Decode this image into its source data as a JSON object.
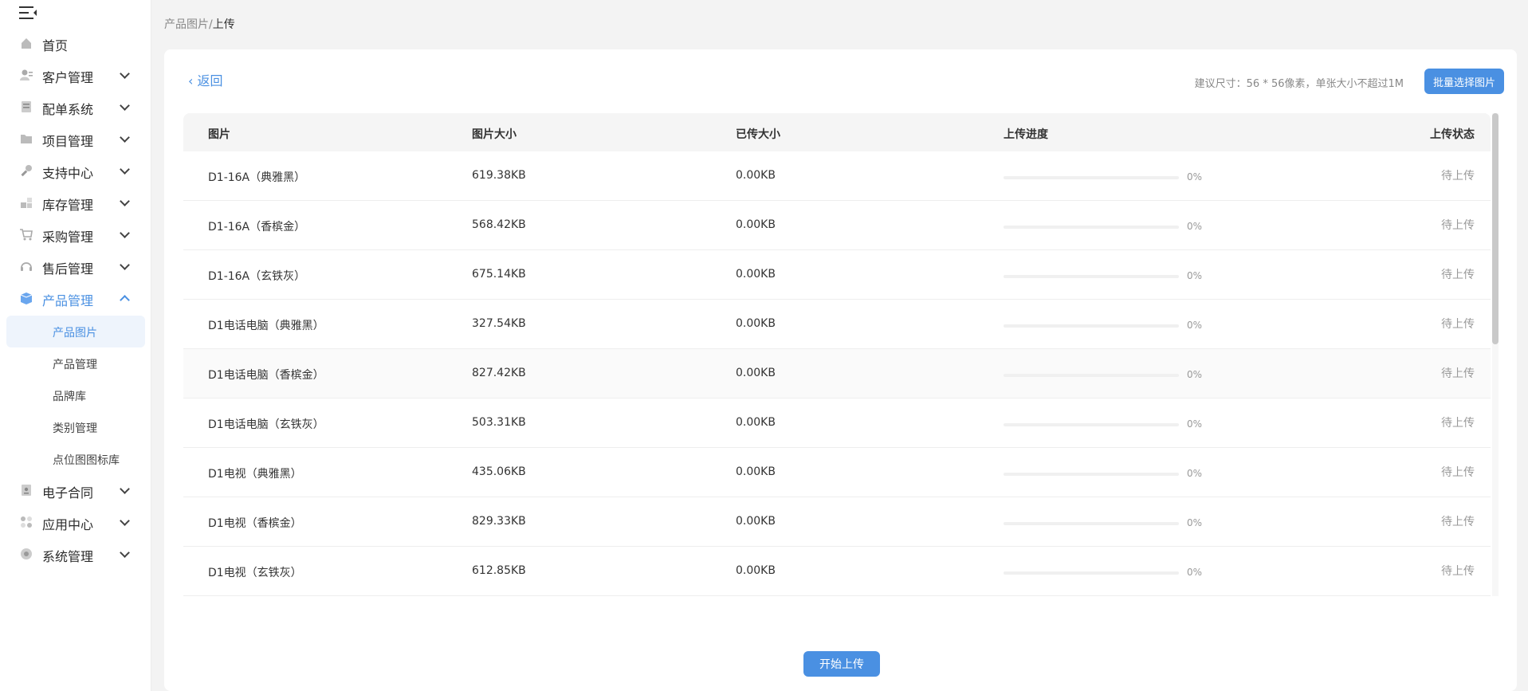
{
  "sidebar": {
    "items": [
      {
        "label": "首页",
        "icon": "home-icon",
        "expandable": false
      },
      {
        "label": "客户管理",
        "icon": "customer-icon",
        "expandable": true
      },
      {
        "label": "配单系统",
        "icon": "order-icon",
        "expandable": true
      },
      {
        "label": "项目管理",
        "icon": "folder-icon",
        "expandable": true
      },
      {
        "label": "支持中心",
        "icon": "wrench-icon",
        "expandable": true
      },
      {
        "label": "库存管理",
        "icon": "inventory-icon",
        "expandable": true
      },
      {
        "label": "采购管理",
        "icon": "cart-icon",
        "expandable": true
      },
      {
        "label": "售后管理",
        "icon": "headset-icon",
        "expandable": true
      },
      {
        "label": "产品管理",
        "icon": "box-icon",
        "expandable": true,
        "active": true
      }
    ],
    "sub_items": [
      {
        "label": "产品图片",
        "active": true
      },
      {
        "label": "产品管理"
      },
      {
        "label": "品牌库"
      },
      {
        "label": "类别管理"
      },
      {
        "label": "点位图图标库"
      }
    ],
    "bottom_items": [
      {
        "label": "电子合同",
        "icon": "contract-icon",
        "expandable": true
      },
      {
        "label": "应用中心",
        "icon": "apps-icon",
        "expandable": true
      },
      {
        "label": "系统管理",
        "icon": "gear-icon",
        "expandable": true
      }
    ]
  },
  "breadcrumb": {
    "parent": "产品图片",
    "separator": "/",
    "current": "上传"
  },
  "toolbar": {
    "back_label": "返回",
    "hint": "建议尺寸：56 * 56像素，单张大小不超过1M",
    "batch_select_label": "批量选择图片"
  },
  "table": {
    "columns": [
      "图片",
      "图片大小",
      "已传大小",
      "上传进度",
      "上传状态"
    ],
    "rows": [
      {
        "name": "D1-16A（典雅黑）",
        "size": "619.38KB",
        "uploaded": "0.00KB",
        "progress": 0,
        "progress_label": "0%",
        "status": "待上传"
      },
      {
        "name": "D1-16A（香槟金）",
        "size": "568.42KB",
        "uploaded": "0.00KB",
        "progress": 0,
        "progress_label": "0%",
        "status": "待上传"
      },
      {
        "name": "D1-16A（玄铁灰）",
        "size": "675.14KB",
        "uploaded": "0.00KB",
        "progress": 0,
        "progress_label": "0%",
        "status": "待上传"
      },
      {
        "name": "D1电话电脑（典雅黑）",
        "size": "327.54KB",
        "uploaded": "0.00KB",
        "progress": 0,
        "progress_label": "0%",
        "status": "待上传"
      },
      {
        "name": "D1电话电脑（香槟金）",
        "size": "827.42KB",
        "uploaded": "0.00KB",
        "progress": 0,
        "progress_label": "0%",
        "status": "待上传"
      },
      {
        "name": "D1电话电脑（玄铁灰）",
        "size": "503.31KB",
        "uploaded": "0.00KB",
        "progress": 0,
        "progress_label": "0%",
        "status": "待上传"
      },
      {
        "name": "D1电视（典雅黑）",
        "size": "435.06KB",
        "uploaded": "0.00KB",
        "progress": 0,
        "progress_label": "0%",
        "status": "待上传"
      },
      {
        "name": "D1电视（香槟金）",
        "size": "829.33KB",
        "uploaded": "0.00KB",
        "progress": 0,
        "progress_label": "0%",
        "status": "待上传"
      },
      {
        "name": "D1电视（玄铁灰）",
        "size": "612.85KB",
        "uploaded": "0.00KB",
        "progress": 0,
        "progress_label": "0%",
        "status": "待上传"
      }
    ]
  },
  "footer": {
    "start_upload_label": "开始上传"
  },
  "colors": {
    "accent": "#4a90e2",
    "background": "#f3f3f3",
    "table_header": "#f5f5f5"
  }
}
